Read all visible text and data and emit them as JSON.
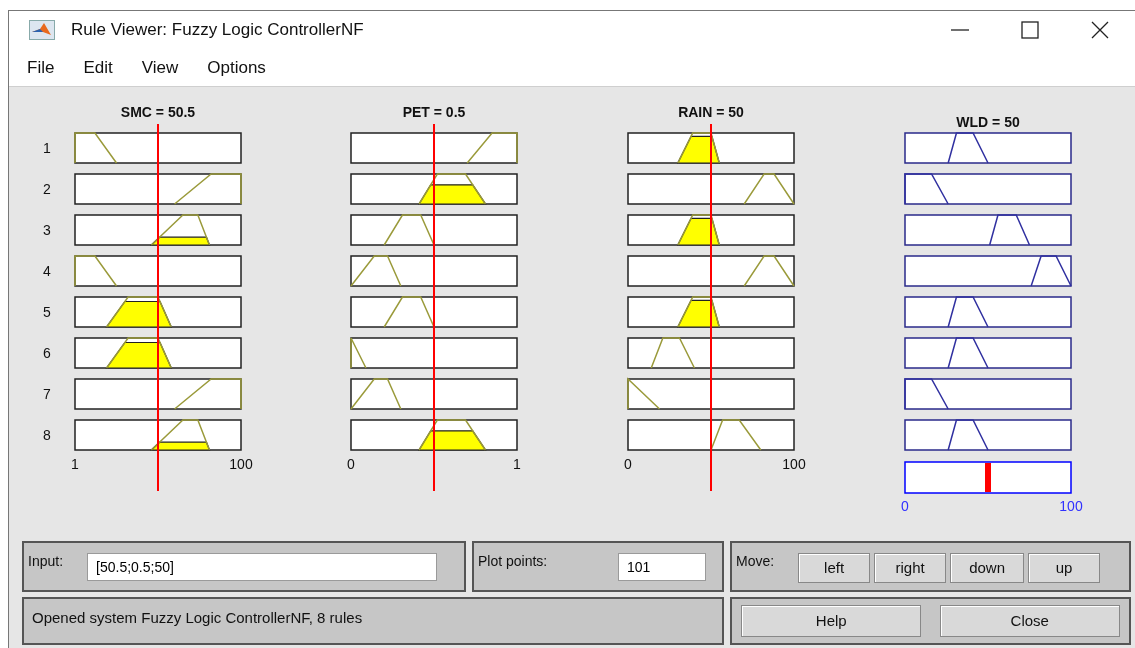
{
  "window": {
    "title": "Rule Viewer: Fuzzy Logic ControllerNF"
  },
  "menu": [
    "File",
    "Edit",
    "View",
    "Options"
  ],
  "inputs": [
    {
      "label": "SMC = 50.5",
      "min": "1",
      "max": "100"
    },
    {
      "label": "PET = 0.5",
      "min": "0",
      "max": "1"
    },
    {
      "label": "RAIN = 50",
      "min": "0",
      "max": "100"
    }
  ],
  "output": {
    "label": "WLD = 50",
    "min": "0",
    "max": "100"
  },
  "rules": [
    {
      "number": "1"
    },
    {
      "number": "2"
    },
    {
      "number": "3"
    },
    {
      "number": "4"
    },
    {
      "number": "5"
    },
    {
      "number": "6"
    },
    {
      "number": "7"
    },
    {
      "number": "8"
    }
  ],
  "input_field": {
    "label": "Input:",
    "value": "[50.5;0.5;50]"
  },
  "plot_points": {
    "label": "Plot points:",
    "value": "101"
  },
  "move": {
    "label": "Move:",
    "buttons": [
      "left",
      "right",
      "down",
      "up"
    ]
  },
  "status": "Opened system Fuzzy Logic ControllerNF, 8 rules",
  "buttons": [
    "Help",
    "Close"
  ]
}
